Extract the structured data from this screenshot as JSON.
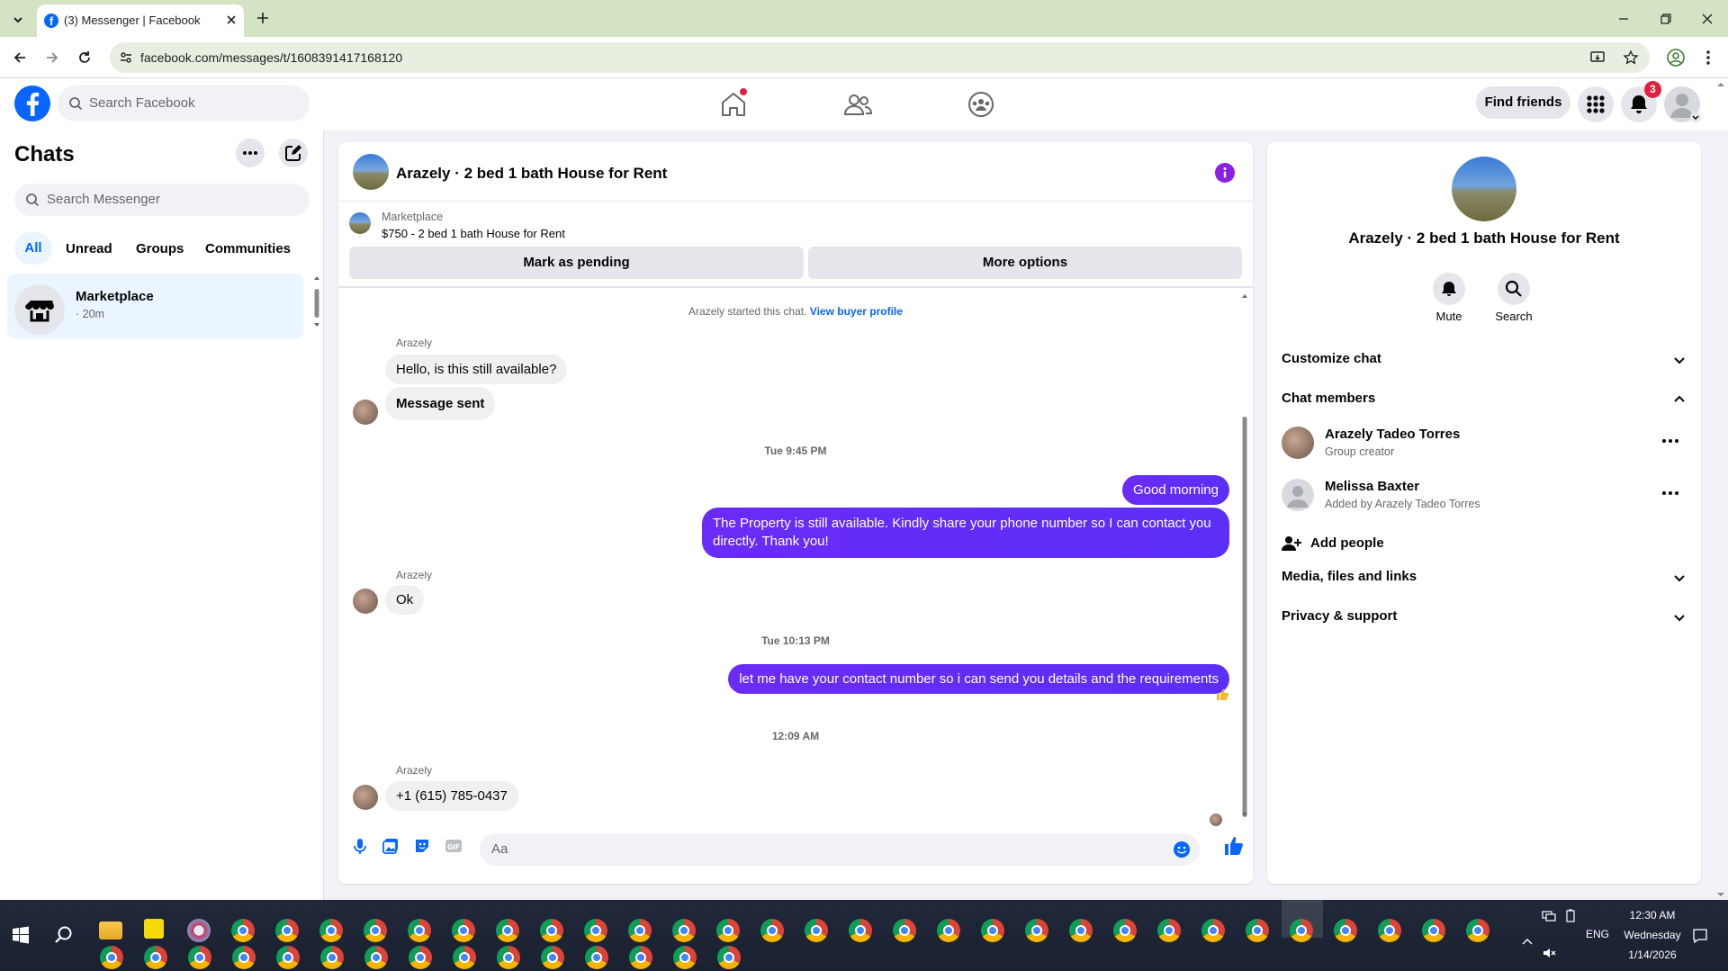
{
  "browser": {
    "tab_title": "(3) Messenger | Facebook",
    "url": "facebook.com/messages/t/1608391417168120"
  },
  "fb_header": {
    "search_placeholder": "Search Facebook",
    "find_friends_label": "Find friends",
    "notification_count": "3"
  },
  "sidebar": {
    "title": "Chats",
    "search_placeholder": "Search Messenger",
    "filters": [
      "All",
      "Unread",
      "Groups",
      "Communities"
    ],
    "chats": [
      {
        "name": "Marketplace",
        "meta": "· 20m"
      }
    ]
  },
  "conversation": {
    "title": "Arazely · 2 bed 1 bath House for Rent",
    "marketplace_label": "Marketplace",
    "listing": "$750 - 2 bed 1 bath House for Rent",
    "mark_pending_label": "Mark as pending",
    "more_options_label": "More options",
    "system_text": "Arazely started this chat.",
    "system_link": "View buyer profile",
    "messages": [
      {
        "sender": "Arazely",
        "text": "Hello, is this still available?"
      },
      {
        "text": "Message sent"
      },
      {
        "time": "Tue 9:45 PM"
      },
      {
        "text": "Good morning"
      },
      {
        "text": "The Property is still available. Kindly share your phone number so I can contact you directly. Thank you!"
      },
      {
        "sender": "Arazely",
        "text": "Ok"
      },
      {
        "time": "Tue 10:13 PM"
      },
      {
        "text": "let me have your contact number so i can send you details and the requirements"
      },
      {
        "time": "12:09 AM"
      },
      {
        "sender": "Arazely",
        "text": "+1 (615) 785-0437"
      }
    ],
    "compose_placeholder": "Aa"
  },
  "right_panel": {
    "title": "Arazely · 2 bed 1 bath House for Rent",
    "mute_label": "Mute",
    "search_label": "Search",
    "customize_label": "Customize chat",
    "members_label": "Chat members",
    "members": [
      {
        "name": "Arazely Tadeo Torres",
        "sub": "Group creator"
      },
      {
        "name": "Melissa Baxter",
        "sub": "Added by Arazely Tadeo Torres"
      }
    ],
    "add_people_label": "Add people",
    "media_label": "Media, files and links",
    "privacy_label": "Privacy & support"
  },
  "taskbar": {
    "time": "12:30 AM",
    "day": "Wednesday",
    "date": "1/14/2026",
    "lang": "ENG"
  },
  "colors": {
    "fb_blue": "#0866ff",
    "outgoing_bubble": "#5b2ff7",
    "badge_red": "#e41e3f"
  }
}
